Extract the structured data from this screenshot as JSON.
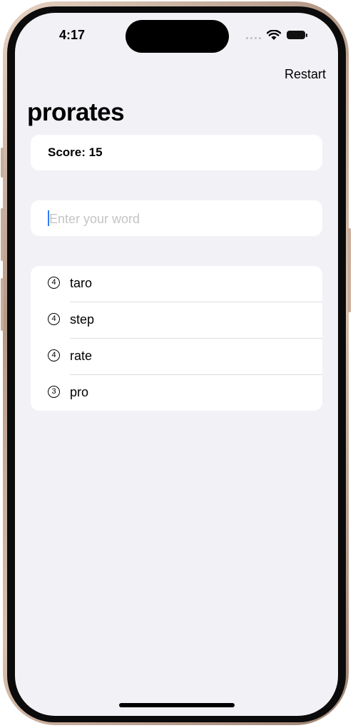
{
  "status_bar": {
    "time": "4:17"
  },
  "nav": {
    "restart_label": "Restart"
  },
  "page": {
    "title": "prorates"
  },
  "score": {
    "text": "Score: 15"
  },
  "input": {
    "placeholder": "Enter your word",
    "value": ""
  },
  "words": [
    {
      "count": "4",
      "word": "taro"
    },
    {
      "count": "4",
      "word": "step"
    },
    {
      "count": "4",
      "word": "rate"
    },
    {
      "count": "3",
      "word": "pro"
    }
  ],
  "colors": {
    "background": "#f2f1f6",
    "card": "#ffffff",
    "caret": "#2f7cf6"
  },
  "icons": {
    "cellular": "cellular-signal-icon",
    "wifi": "wifi-icon",
    "battery": "battery-icon"
  }
}
